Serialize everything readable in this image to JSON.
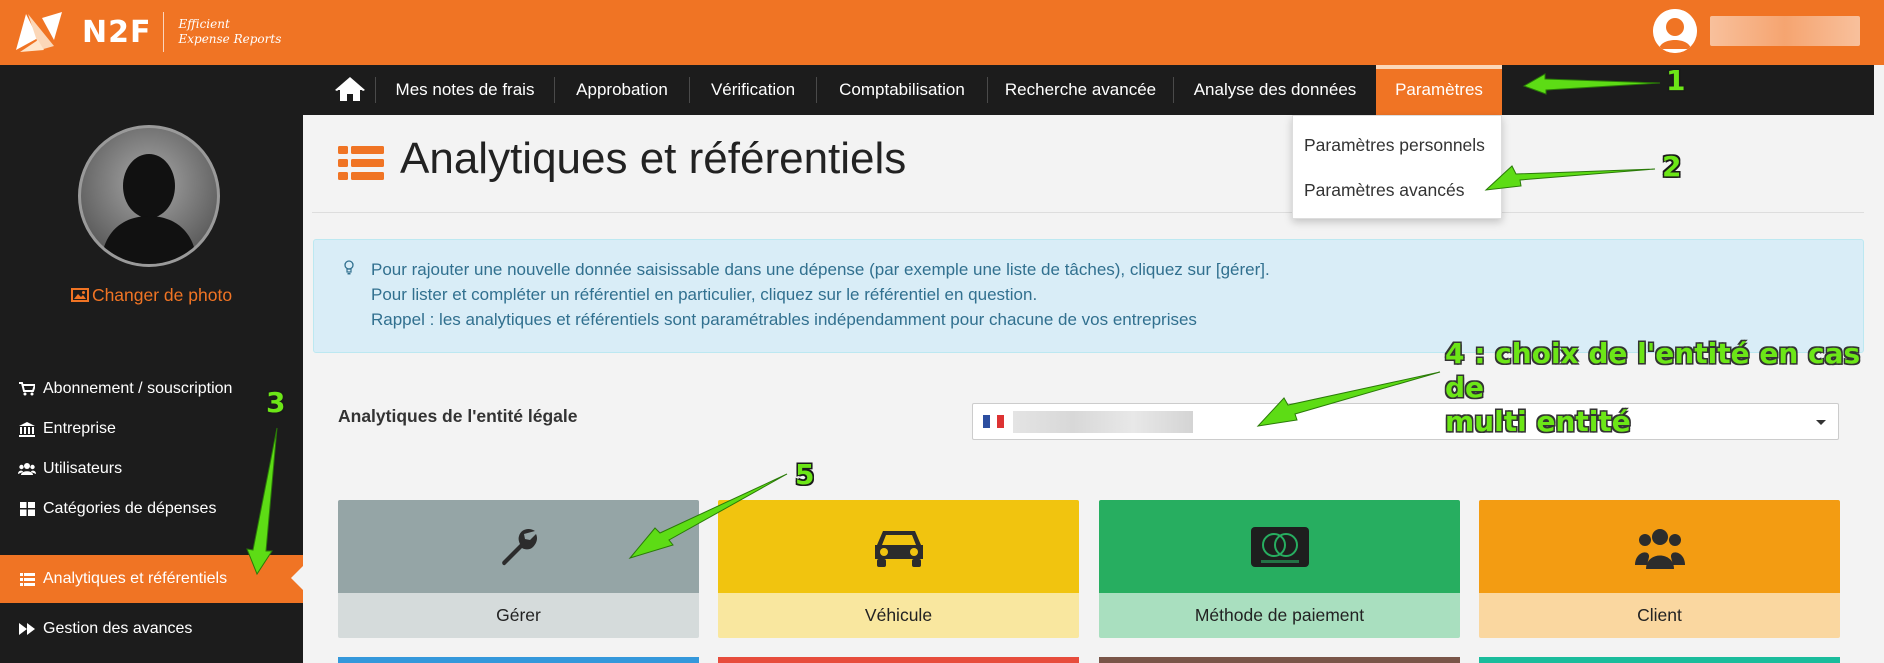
{
  "header": {
    "brand": "N2F",
    "tagline_1": "Efficient",
    "tagline_2": "Expense Reports",
    "accent": "#f07424"
  },
  "nav": {
    "items": [
      "Mes notes de frais",
      "Approbation",
      "Vérification",
      "Comptabilisation",
      "Recherche avancée",
      "Analyse des données",
      "Paramètres"
    ],
    "active": "Paramètres"
  },
  "dropdown": {
    "items": [
      "Paramètres personnels",
      "Paramètres avancés"
    ]
  },
  "sidebar": {
    "change_photo": "Changer de photo",
    "items": [
      {
        "label": "Abonnement / souscription",
        "icon": "cart-icon"
      },
      {
        "label": "Entreprise",
        "icon": "bank-icon"
      },
      {
        "label": "Utilisateurs",
        "icon": "users-icon"
      },
      {
        "label": "Catégories de dépenses",
        "icon": "grid-icon"
      },
      {
        "label": "Analytiques et référentiels",
        "icon": "list-icon",
        "active": true
      },
      {
        "label": "Gestion des avances",
        "icon": "forward-icon"
      }
    ]
  },
  "main": {
    "title": "Analytiques et référentiels",
    "info_lines": [
      "Pour rajouter une nouvelle donnée saisissable dans une dépense (par exemple une liste de tâches), cliquez sur [gérer].",
      "Pour lister et compléter un référentiel en particulier, cliquez sur le référentiel en question.",
      "Rappel : les analytiques et référentiels sont paramétrables indépendamment pour chacune de vos entreprises"
    ],
    "entity_label": "Analytiques de l'entité légale",
    "tiles": [
      {
        "label": "Gérer",
        "icon": "wrench-icon",
        "top_color": "#95a5a6",
        "bottom_color": "#d5dbdb"
      },
      {
        "label": "Véhicule",
        "icon": "car-icon",
        "top_color": "#f1c40f",
        "bottom_color": "#f9e79f"
      },
      {
        "label": "Méthode de paiement",
        "icon": "credit-card-icon",
        "top_color": "#27ae60",
        "bottom_color": "#a9dfbf"
      },
      {
        "label": "Client",
        "icon": "users-icon",
        "top_color": "#f39c12",
        "bottom_color": "#fad7a0"
      }
    ]
  },
  "annotations": {
    "n1": "1",
    "n2": "2",
    "n3": "3",
    "n4_line1": "4 : choix de l'entité en cas de",
    "n4_line2": "multi entité",
    "n5": "5",
    "color": "#6ce617"
  }
}
